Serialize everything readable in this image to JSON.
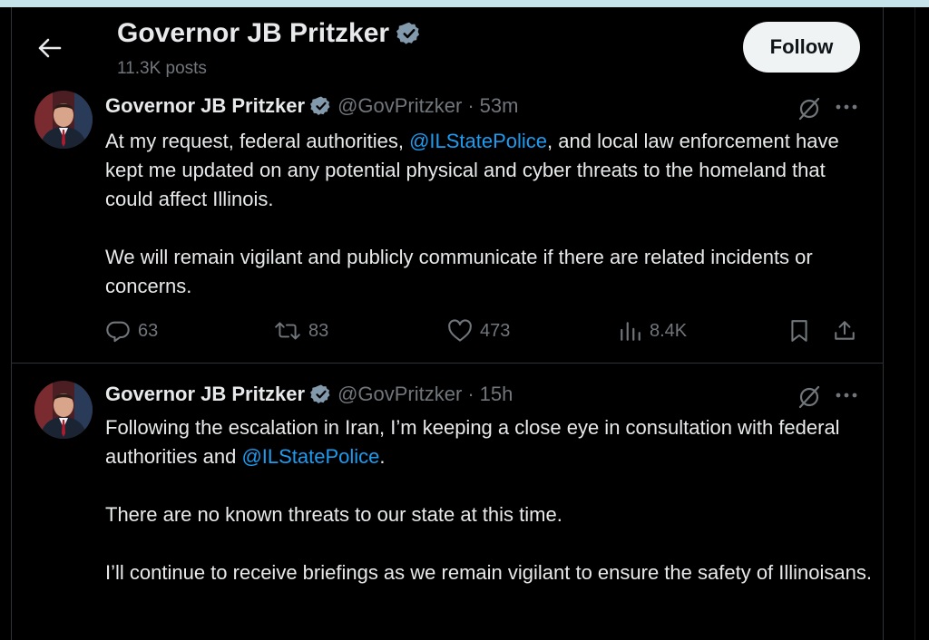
{
  "header": {
    "title": "Governor JB Pritzker",
    "post_count": "11.3K posts",
    "follow_label": "Follow"
  },
  "colors": {
    "background": "#000000",
    "text": "#e7e9ea",
    "muted": "#71767b",
    "link": "#1d9bf0",
    "verified": "#e7e9ea",
    "follow_bg": "#eff3f4"
  },
  "tweets": [
    {
      "name": "Governor JB Pritzker",
      "handle": "@GovPritzker",
      "dot": "·",
      "time": "53m",
      "body": {
        "p1_before": "At my request, federal authorities, ",
        "p1_mention": "@ILStatePolice",
        "p1_after": ", and local law enforcement have kept me updated on any potential physical and cyber threats to the homeland that could affect Illinois.",
        "p2": "We will remain vigilant and publicly communicate if there are related incidents or concerns."
      },
      "stats": {
        "replies": "63",
        "reposts": "83",
        "likes": "473",
        "views": "8.4K"
      }
    },
    {
      "name": "Governor JB Pritzker",
      "handle": "@GovPritzker",
      "dot": "·",
      "time": "15h",
      "body": {
        "p1_before": "Following the escalation in Iran, I’m keeping a close eye in consultation with federal authorities and ",
        "p1_mention": "@ILStatePolice",
        "p1_after": ".",
        "p2": "There are no known threats to our state at this time.",
        "p3": "I’ll continue to receive briefings as we remain vigilant to ensure the safety of Illinoisans."
      }
    }
  ],
  "icons": {
    "back": "arrow-left-icon",
    "verified": "verified-badge-icon",
    "grok": "grok-icon",
    "more": "more-dots-icon",
    "reply": "reply-icon",
    "repost": "repost-icon",
    "like": "heart-icon",
    "views": "views-icon",
    "bookmark": "bookmark-icon",
    "share": "share-icon"
  }
}
